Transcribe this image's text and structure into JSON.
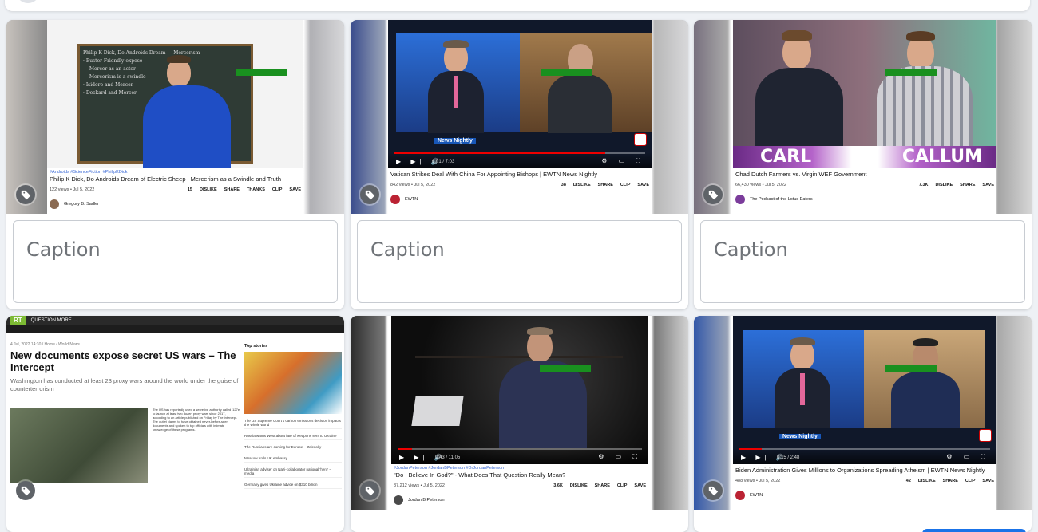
{
  "placeholder_caption": "Caption",
  "cards": [
    {
      "tags": "#Androids #ScienceFiction #PhilipKDick",
      "title": "Philip K Dick, Do Androids Dream of Electric Sheep | Mercerism as a Swindle and Truth",
      "meta": "122 views • Jul 5, 2022",
      "actions": [
        "15",
        "DISLIKE",
        "SHARE",
        "THANKS",
        "CLIP",
        "SAVE"
      ],
      "channel": "Gregory B. Sadler"
    },
    {
      "title": "Vatican Strikes Deal With China For Appointing Bishops | EWTN News Nightly",
      "meta": "842 views • Jul 5, 2022",
      "actions": [
        "38",
        "DISLIKE",
        "SHARE",
        "CLIP",
        "SAVE"
      ],
      "channel": "EWTN",
      "ticker": "News Nightly",
      "time": "6:01 / 7:03"
    },
    {
      "title": "Chad Dutch Farmers vs. Virgin WEF Government",
      "meta": "66,430 views • Jul 5, 2022",
      "actions": [
        "7.3K",
        "DISLIKE",
        "SHARE",
        "SAVE"
      ],
      "channel": "The Podcast of the Lotus Eaters",
      "lower_left": "CARL",
      "lower_right": "CALLUM"
    },
    {
      "site": "RT",
      "tagline": "QUESTION MORE",
      "date": "4 Jul, 2022 14:30 / Home / World News",
      "headline": "New documents expose secret US wars – The Intercept",
      "lede": "Washington has conducted at least 23 proxy wars around the world under the guise of counterterrorism",
      "side_title": "Top stories",
      "side_items": [
        "The US Supreme Court's carbon emissions decision impacts the whole world",
        "Russia warns West about fate of weapons sent to Ukraine",
        "The Russians are coming for Europe – Zelensky",
        "Moscow trolls UK embassy",
        "Ukrainian adviser on Nazi-collaborator national 'hero' – media",
        "Germany gives Ukraine advice on $310 billion"
      ],
      "body": "The US has reportedly used a secretive authority called '127e' to launch at least two dozen proxy wars since 2017, according to an article published on Friday by The Intercept. The outlet claims to have obtained never-before-seen documents and spoken to top officials with intimate knowledge of these programs."
    },
    {
      "tags": "#JordanPeterson #JordanBPeterson #DrJordanPeterson",
      "title": "\"Do I Believe In God?\" - What Does That Question Really Mean?",
      "meta": "37,212 views • Jul 5, 2022",
      "actions": [
        "3.6K",
        "DISLIKE",
        "SHARE",
        "CLIP",
        "SAVE"
      ],
      "channel": "Jordan B Peterson",
      "time": "0:43 / 11:05"
    },
    {
      "title": "Biden Administration Gives Millions to Organizations Spreading Atheism | EWTN News Nightly",
      "meta": "488 views • Jul 5, 2022",
      "actions": [
        "42",
        "DISLIKE",
        "SHARE",
        "CLIP",
        "SAVE"
      ],
      "channel": "EWTN",
      "ticker": "News Nightly",
      "time": "0:15 / 2:48"
    }
  ]
}
